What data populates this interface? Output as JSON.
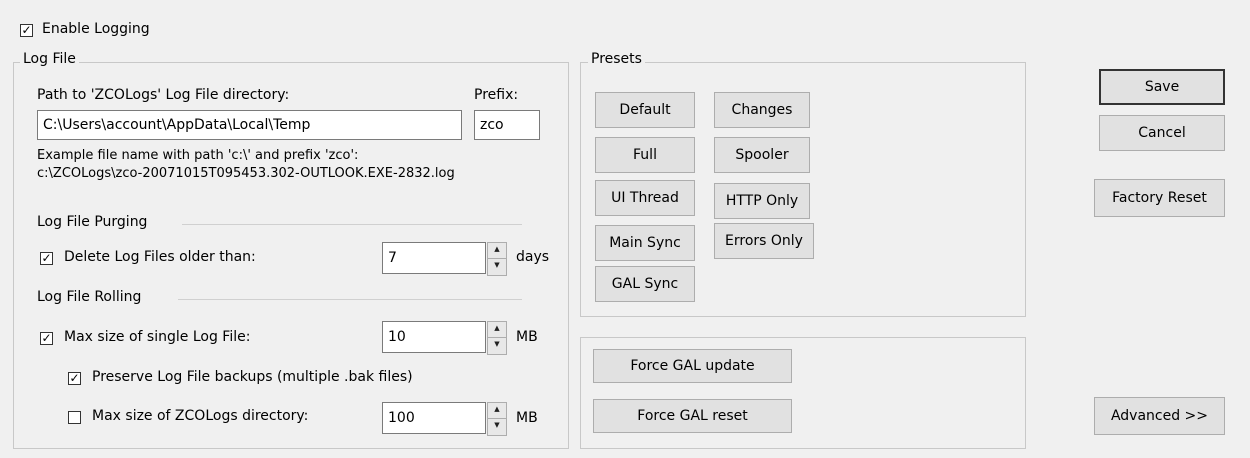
{
  "enable_logging": {
    "label": "Enable Logging",
    "checked": true
  },
  "log_file": {
    "title": "Log File",
    "path_label": "Path to 'ZCOLogs' Log File directory:",
    "path_value": "C:\\Users\\account\\AppData\\Local\\Temp",
    "prefix_label": "Prefix:",
    "prefix_value": "zco",
    "example_line1": "Example file name with path 'c:\\' and prefix 'zco':",
    "example_line2": "c:\\ZCOLogs\\zco-20071015T095453.302-OUTLOOK.EXE-2832.log",
    "purging": {
      "title": "Log File Purging",
      "delete_label": "Delete Log Files older than:",
      "delete_checked": true,
      "days_value": "7",
      "days_unit": "days"
    },
    "rolling": {
      "title": "Log File Rolling",
      "max_size_label": "Max size of single Log File:",
      "max_size_checked": true,
      "max_size_value": "10",
      "max_size_unit": "MB",
      "preserve_label": "Preserve Log File backups (multiple .bak files)",
      "preserve_checked": true,
      "dir_size_label": "Max size of ZCOLogs directory:",
      "dir_size_checked": false,
      "dir_size_value": "100",
      "dir_size_unit": "MB"
    }
  },
  "presets": {
    "title": "Presets",
    "buttons": [
      "Default",
      "Changes",
      "Full",
      "Spooler",
      "UI Thread",
      "HTTP Only",
      "Main Sync",
      "Errors Only",
      "GAL Sync"
    ]
  },
  "gal": {
    "force_update": "Force GAL update",
    "force_reset": "Force GAL reset"
  },
  "actions": {
    "save": "Save",
    "cancel": "Cancel",
    "factory_reset": "Factory Reset",
    "advanced": "Advanced >>"
  },
  "check_glyph": "✓"
}
